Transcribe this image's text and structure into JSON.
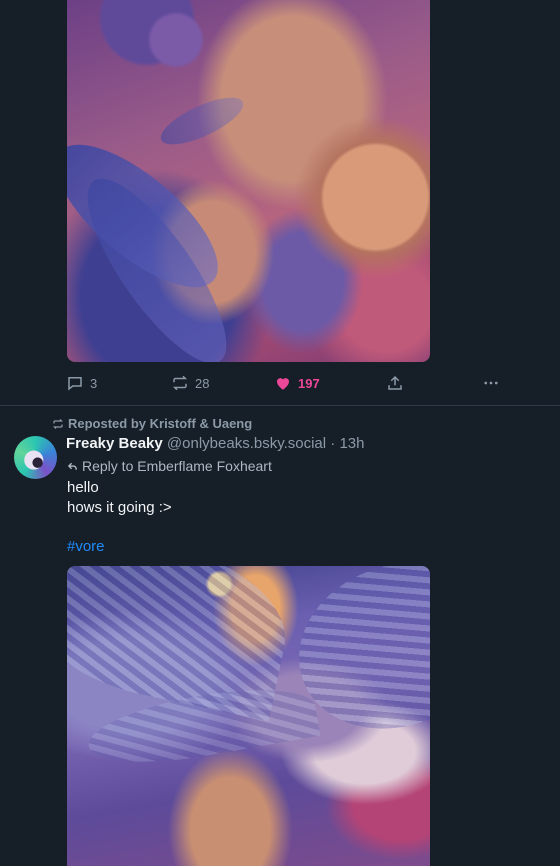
{
  "previous_post": {
    "image_alt": "",
    "actions": {
      "replies": "3",
      "reposts": "28",
      "likes": "197"
    }
  },
  "post": {
    "repost_label": "Reposted by Kristoff & Uaeng",
    "author_name": "Freaky Beaky",
    "author_handle": "@onlybeaks.bsky.social",
    "separator": "·",
    "time": "13h",
    "reply_to": "Reply to Emberflame Foxheart",
    "text_lines": [
      "hello",
      "hows it going :>"
    ],
    "hashtag": "#vore"
  },
  "colors": {
    "background": "#161e27",
    "accent_blue": "#208bfe",
    "like_pink": "#ec4899",
    "muted": "#8c9aa8"
  },
  "icons": [
    "reply-icon",
    "repost-icon",
    "heart-icon",
    "share-icon",
    "more-icon",
    "small-repost-icon",
    "reply-arrow-icon"
  ]
}
